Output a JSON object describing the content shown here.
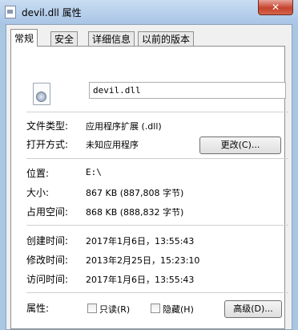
{
  "window": {
    "title": "devil.dll 属性",
    "close_label": "✕"
  },
  "tabs": [
    "常规",
    "安全",
    "详细信息",
    "以前的版本"
  ],
  "general": {
    "file_name": "devil.dll",
    "file_type": {
      "label": "文件类型:",
      "value": "应用程序扩展 (.dll)"
    },
    "opens_with": {
      "label": "打开方式:",
      "value": "未知应用程序",
      "change_button": "更改(C)..."
    },
    "location": {
      "label": "位置:",
      "value": "E:\\"
    },
    "size": {
      "label": "大小:",
      "value": "867 KB (887,808 字节)"
    },
    "size_on_disk": {
      "label": "占用空间:",
      "value": "868 KB (888,832 字节)"
    },
    "created": {
      "label": "创建时间:",
      "value": "2017年1月6日，13:55:43"
    },
    "modified": {
      "label": "修改时间:",
      "value": "2013年2月25日，15:23:10"
    },
    "accessed": {
      "label": "访问时间:",
      "value": "2017年1月6日，13:55:43"
    },
    "attributes": {
      "label": "属性:",
      "readonly_label": "只读(R)",
      "readonly_checked": false,
      "hidden_label": "隐藏(H)",
      "hidden_checked": false,
      "advanced_button": "高级(D)..."
    }
  },
  "icons": {
    "app": "dll-file-icon",
    "file": "dll-file-large-icon"
  }
}
